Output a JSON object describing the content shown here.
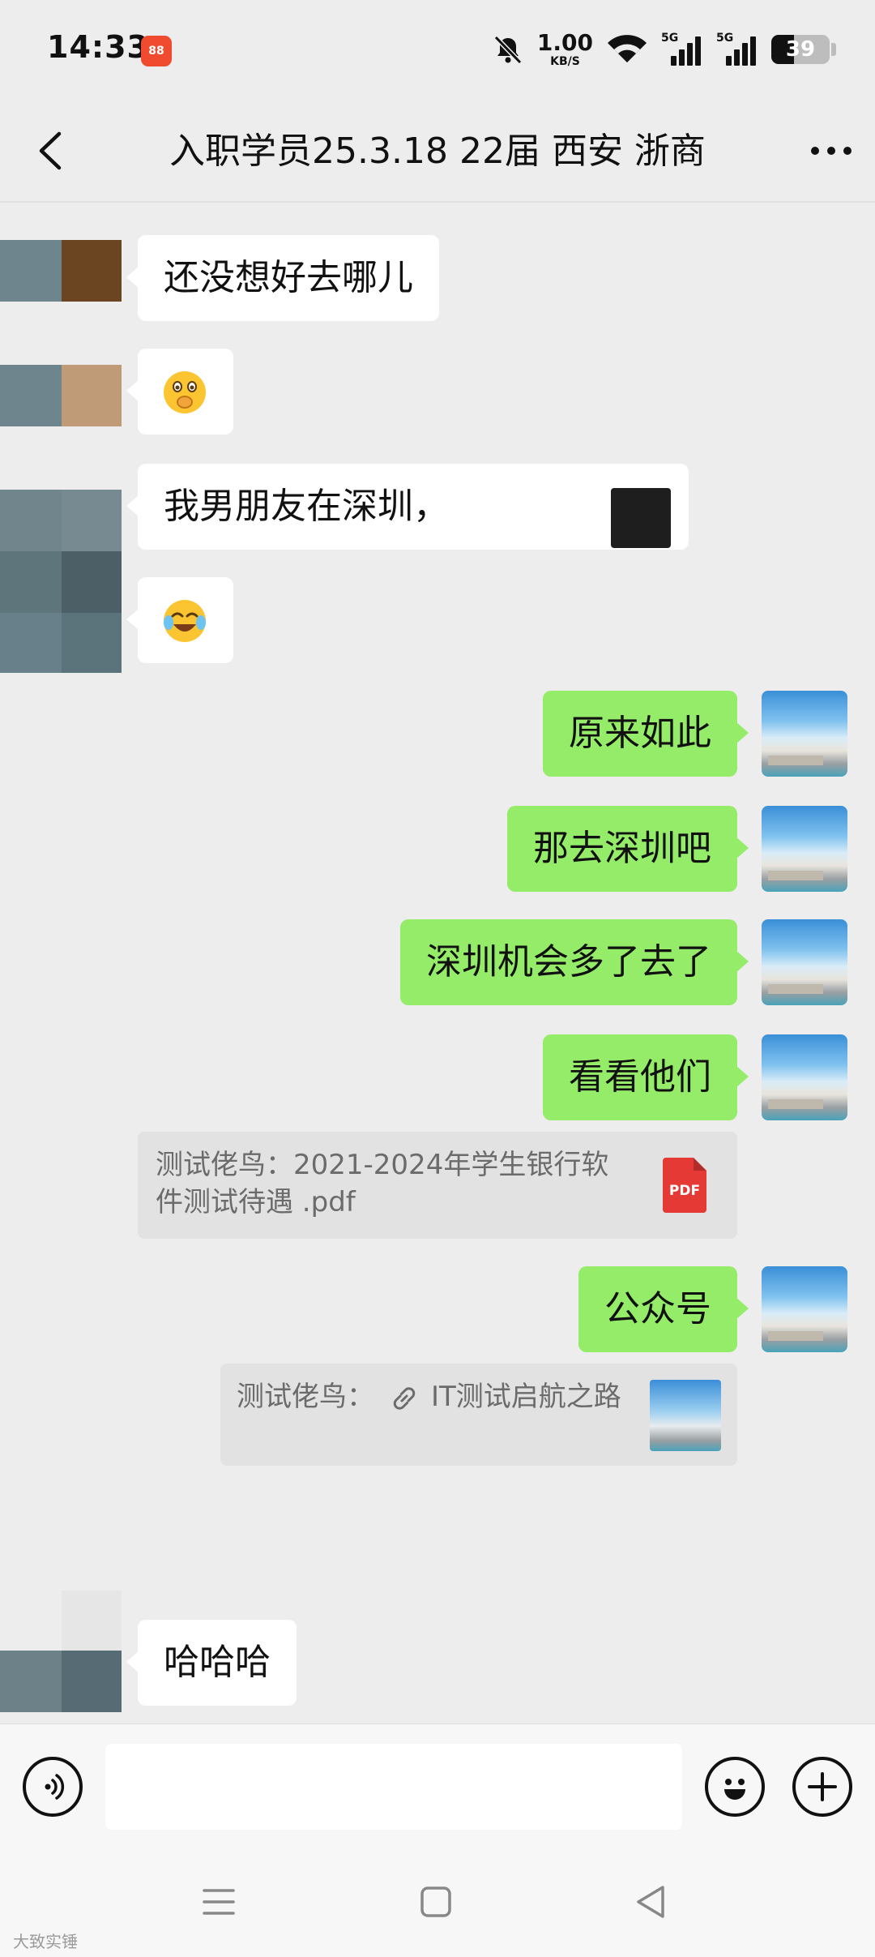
{
  "status_bar": {
    "time": "14:33",
    "app_badge": "88",
    "net_speed_value": "1.00",
    "net_speed_unit": "KB/S",
    "sim1": "5G",
    "sim2": "5G",
    "battery": "39",
    "battery_level": 0.39,
    "icons": [
      "mute-bell-icon",
      "wifi-icon",
      "signal-icon",
      "battery-icon"
    ]
  },
  "header": {
    "title": "入职学员25.3.18 22届 西安 浙商",
    "icons": [
      "back-icon",
      "more-icon"
    ]
  },
  "messages": [
    {
      "side": "in",
      "type": "text",
      "text": "还没想好去哪儿"
    },
    {
      "side": "in",
      "type": "emoji",
      "emoji": "face-with-hand-over-mouth"
    },
    {
      "side": "in",
      "type": "text",
      "text": "我男朋友在深圳，"
    },
    {
      "side": "in",
      "type": "emoji",
      "emoji": "face-with-tears-of-joy"
    },
    {
      "side": "out",
      "type": "text",
      "text": "原来如此"
    },
    {
      "side": "out",
      "type": "text",
      "text": "那去深圳吧"
    },
    {
      "side": "out",
      "type": "text",
      "text": "深圳机会多了去了"
    },
    {
      "side": "out",
      "type": "text",
      "text": "看看他们"
    },
    {
      "side": "out",
      "type": "quote-file",
      "line1": "测试佬鸟：2021-2024年学生银行软",
      "line2": "件测试待遇 .pdf",
      "file_icon_label": "PDF"
    },
    {
      "side": "out",
      "type": "text",
      "text": "公众号"
    },
    {
      "side": "out",
      "type": "quote-link",
      "sender": "测试佬鸟：",
      "text": "IT测试启航之路"
    },
    {
      "side": "in",
      "type": "text",
      "text": "哈哈哈"
    }
  ],
  "input_bar": {
    "placeholder": "",
    "icons": [
      "voice-icon",
      "emoji-icon",
      "plus-icon"
    ]
  },
  "system_nav": {
    "icons": [
      "menu-icon",
      "home-icon",
      "back-triangle-icon"
    ]
  },
  "watermark": "大致实锤",
  "colors": {
    "background": "#ededed",
    "outgoing_bubble": "#95ec69",
    "incoming_bubble": "#ffffff",
    "quote_background": "#e2e2e2",
    "pdf_red": "#e53935"
  }
}
